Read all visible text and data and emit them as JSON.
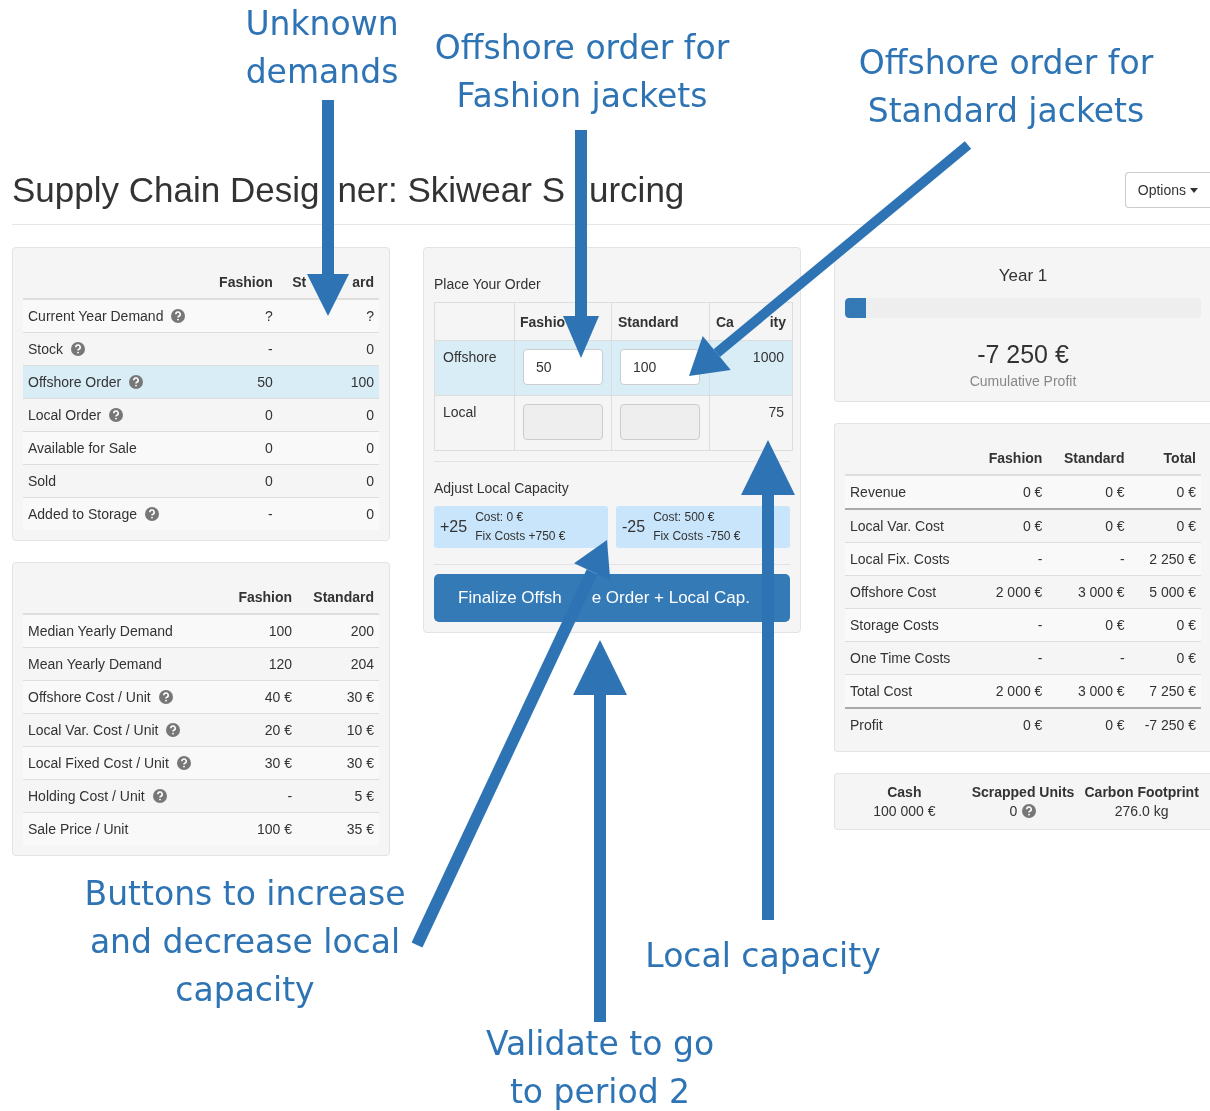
{
  "annotations_top": [
    {
      "lines": [
        "Unknown",
        "demands"
      ]
    },
    {
      "lines": [
        "Offshore order for",
        "Fashion jackets"
      ]
    },
    {
      "lines": [
        "Offshore order for",
        "Standard jackets"
      ]
    }
  ],
  "page": {
    "title_parts": [
      "Supply Chain Desig",
      "ner: Skiwear S",
      "urcing"
    ],
    "options_button": "Options"
  },
  "status_table": {
    "columns": [
      [
        "Fashion"
      ],
      [
        "St",
        "ard"
      ]
    ],
    "rows": [
      {
        "label": "Current Year Demand",
        "help": true,
        "highlighted": false,
        "values": [
          "?",
          "?"
        ]
      },
      {
        "label": "Stock",
        "help": true,
        "highlighted": false,
        "values": [
          "-",
          "0"
        ]
      },
      {
        "label": "Offshore Order",
        "help": true,
        "highlighted": true,
        "values": [
          "50",
          "100"
        ]
      },
      {
        "label": "Local Order",
        "help": true,
        "highlighted": false,
        "values": [
          "0",
          "0"
        ]
      },
      {
        "label": "Available for Sale",
        "help": false,
        "highlighted": false,
        "values": [
          "0",
          "0"
        ]
      },
      {
        "label": "Sold",
        "help": false,
        "highlighted": false,
        "values": [
          "0",
          "0"
        ]
      },
      {
        "label": "Added to Storage",
        "help": true,
        "highlighted": false,
        "values": [
          "-",
          "0"
        ]
      }
    ]
  },
  "parameters_table": {
    "columns": [
      "Fashion",
      "Standard"
    ],
    "rows": [
      {
        "label": "Median Yearly Demand",
        "help": false,
        "values": [
          "100",
          "200"
        ]
      },
      {
        "label": "Mean Yearly Demand",
        "help": false,
        "values": [
          "120",
          "204"
        ]
      },
      {
        "label": "Offshore Cost / Unit",
        "help": true,
        "values": [
          "40 €",
          "30 €"
        ]
      },
      {
        "label": "Local Var. Cost / Unit",
        "help": true,
        "values": [
          "20 €",
          "10 €"
        ]
      },
      {
        "label": "Local Fixed Cost / Unit",
        "help": true,
        "values": [
          "30 €",
          "30 €"
        ]
      },
      {
        "label": "Holding Cost / Unit",
        "help": true,
        "values": [
          "-",
          "5 €"
        ]
      },
      {
        "label": "Sale Price / Unit",
        "help": false,
        "values": [
          "100 €",
          "35 €"
        ]
      }
    ]
  },
  "order": {
    "title": "Place Your Order",
    "columns": [
      [
        "Fashio"
      ],
      [
        "Standard"
      ],
      [
        "Ca",
        "ity"
      ]
    ],
    "rows": [
      {
        "label": "Offshore",
        "highlighted": true,
        "inputs": [
          {
            "value": "50",
            "disabled": false
          },
          {
            "value": "100",
            "disabled": false
          }
        ],
        "capacity": "1000"
      },
      {
        "label": "Local",
        "highlighted": false,
        "inputs": [
          {
            "disabled": true
          },
          {
            "disabled": true
          }
        ],
        "capacity": "75"
      }
    ],
    "capacity_title": "Adjust Local Capacity",
    "capacity_buttons": [
      {
        "amount": "+25",
        "cost": "Cost: 0 €",
        "fix": "Fix Costs +750 €"
      },
      {
        "amount": "-25",
        "cost": "Cost: 500 €",
        "fix": "Fix Costs -750 €"
      }
    ],
    "finalize_button_parts": [
      "Finalize Offsh",
      "e Order + Local Cap."
    ]
  },
  "year": {
    "title": "Year 1",
    "level": 0.06,
    "profit": "-7 250 €",
    "profit_label": "Cumulative Profit"
  },
  "costs_table": {
    "columns": [
      "Fashion",
      "Standard",
      "Total"
    ],
    "rows": [
      {
        "label": "Revenue",
        "line_below": true,
        "values": [
          "0 €",
          "0 €",
          "0 €"
        ]
      },
      {
        "label": "Local Var. Cost",
        "line_below": false,
        "values": [
          "0 €",
          "0 €",
          "0 €"
        ]
      },
      {
        "label": "Local Fix. Costs",
        "line_below": false,
        "values": [
          "-",
          "-",
          "2 250 €"
        ]
      },
      {
        "label": "Offshore Cost",
        "line_below": false,
        "values": [
          "2 000 €",
          "3 000 €",
          "5 000 €"
        ]
      },
      {
        "label": "Storage Costs",
        "line_below": false,
        "values": [
          "-",
          "0 €",
          "0 €"
        ]
      },
      {
        "label": "One Time Costs",
        "line_below": false,
        "values": [
          "-",
          "-",
          "0 €"
        ]
      },
      {
        "label": "Total Cost",
        "line_below": true,
        "values": [
          "2 000 €",
          "3 000 €",
          "7 250 €"
        ]
      },
      {
        "label": "Profit",
        "line_below": false,
        "values": [
          "0 €",
          "0 €",
          "-7 250 €"
        ]
      }
    ]
  },
  "stats": [
    {
      "label": "Cash",
      "value": "100 000 €",
      "help": false
    },
    {
      "label": "Scrapped Units",
      "value": "0",
      "help": true
    },
    {
      "label": "Carbon Footprint",
      "value": "276.0 kg",
      "help": false
    }
  ],
  "annotations_bottom": [
    {
      "lines": [
        "Buttons to increase",
        "and decrease local",
        "capacity"
      ]
    },
    {
      "lines": [
        "Local capacity"
      ]
    },
    {
      "lines": [
        "Validate to go",
        "to period 2"
      ]
    }
  ]
}
